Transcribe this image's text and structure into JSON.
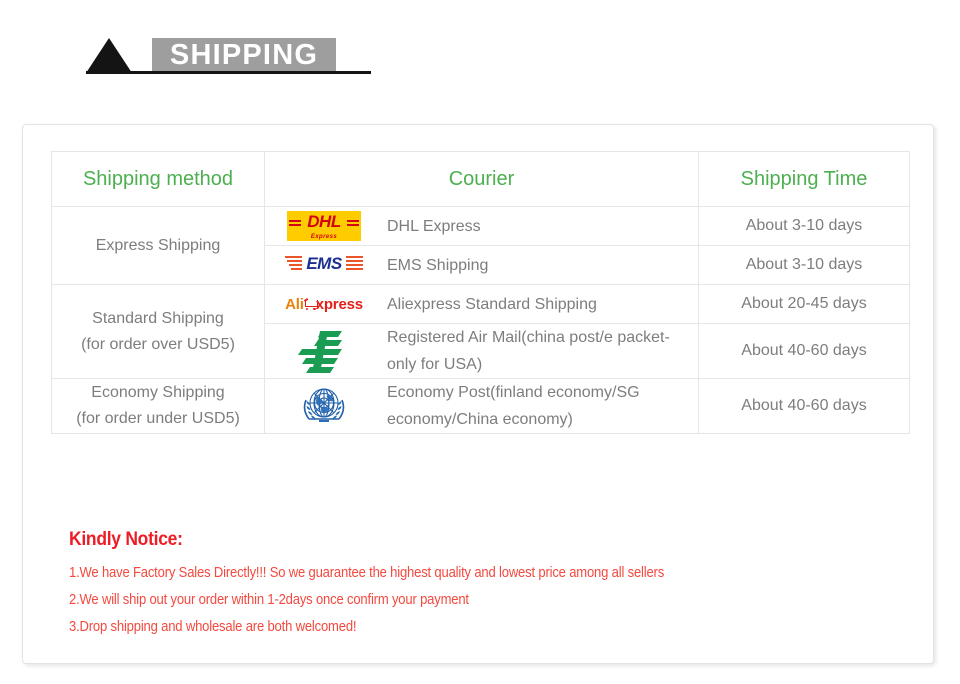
{
  "banner": {
    "title": "SHIPPING",
    "box_color": "#9e9e9e",
    "title_color": "#ffffff",
    "triangle_color": "#141414"
  },
  "table": {
    "headers": {
      "method": "Shipping method",
      "courier": "Courier",
      "time": "Shipping Time"
    },
    "header_color": "#4caf50",
    "methods": [
      {
        "label": "Express Shipping",
        "sub": ""
      },
      {
        "label": "Standard Shipping",
        "sub": "(for order over USD5)"
      },
      {
        "label": "Economy Shipping",
        "sub": "(for order under USD5)"
      }
    ],
    "rows": [
      {
        "logo": "dhl-logo",
        "logo_text": "DHL",
        "logo_sub": "Express",
        "courier": "DHL Express",
        "time": "About 3-10 days"
      },
      {
        "logo": "ems-logo",
        "logo_text": "EMS",
        "courier": "EMS Shipping",
        "time": "About 3-10 days"
      },
      {
        "logo": "aliexpress-logo",
        "logo_text_a": "Ali",
        "logo_text_b": "xpress",
        "courier": "Aliexpress Standard Shipping",
        "time": "About 20-45 days"
      },
      {
        "logo": "china-post-logo",
        "courier": "Registered Air Mail(china post/e packet-only for USA)",
        "time": "About 40-60 days"
      },
      {
        "logo": "united-nations-logo",
        "courier": "Economy Post(finland economy/SG economy/China economy)",
        "time": "About 40-60 days"
      }
    ]
  },
  "notice": {
    "title": "Kindly Notice:",
    "title_color": "#ee1c25",
    "line_color": "#f4493f",
    "lines": [
      "1.We have Factory Sales Directly!!! So we guarantee the highest quality and lowest price among all sellers",
      "2.We will ship out your order within 1-2days once confirm your payment",
      "3.Drop shipping and wholesale are both welcomed!"
    ]
  }
}
